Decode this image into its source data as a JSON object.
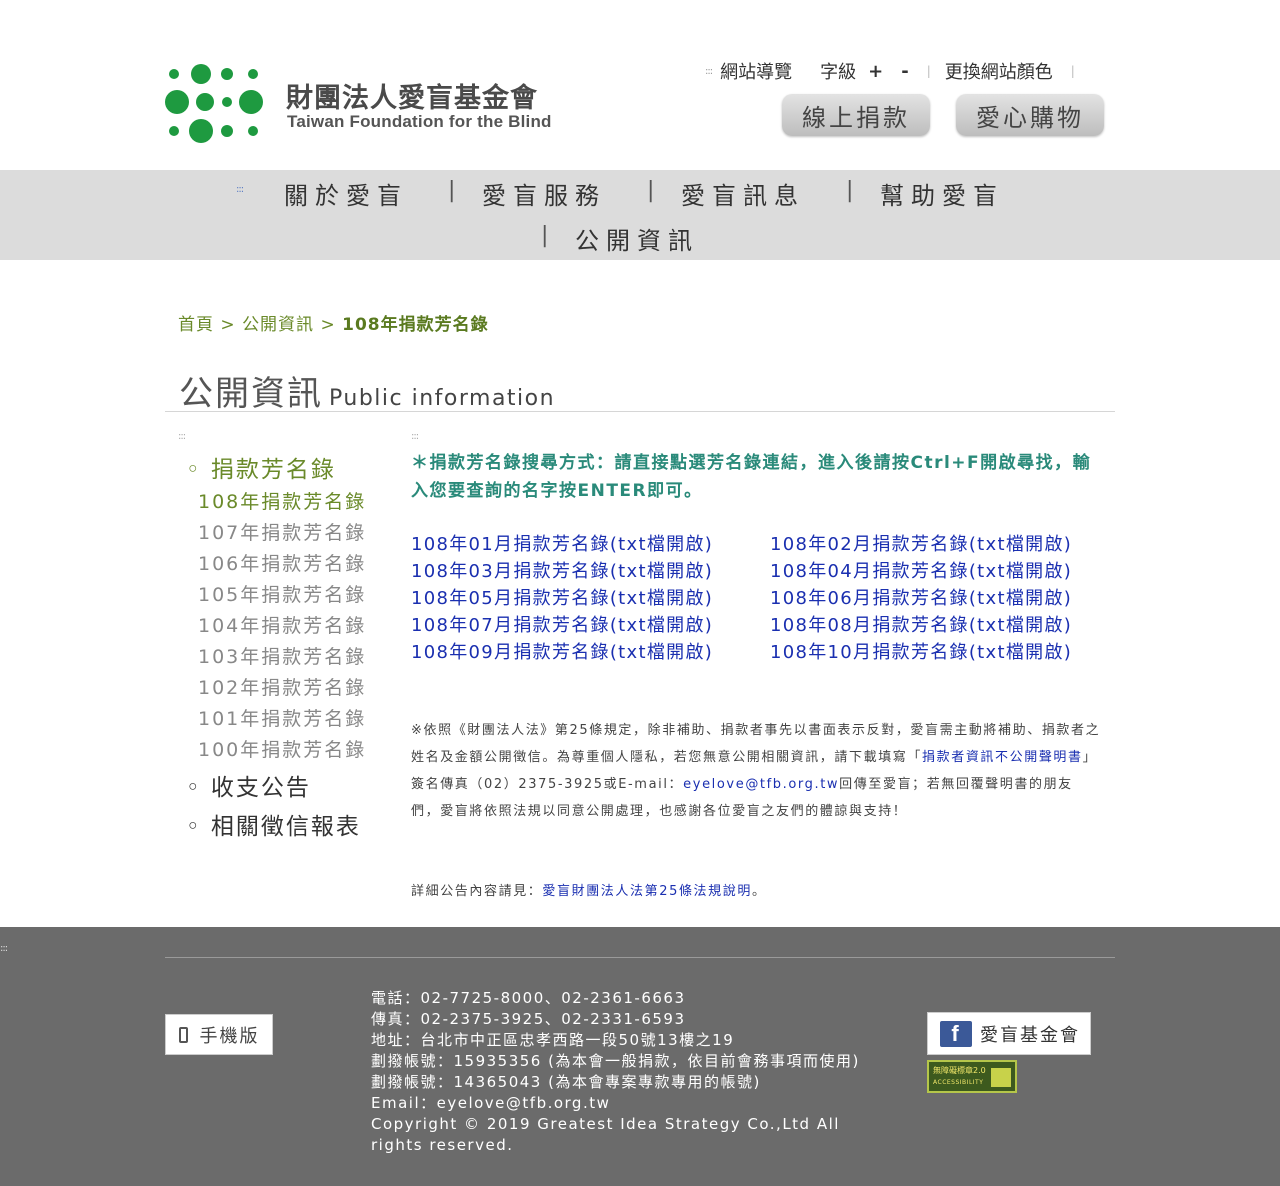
{
  "header": {
    "org_name_cn": "財團法人愛盲基金會",
    "org_name_en": "Taiwan Foundation for the Blind",
    "sitemap_label": "網站導覽",
    "font_size_label": "字級",
    "font_increase": "+",
    "font_decrease": "-",
    "change_color_label": "更換網站顏色",
    "donate_button": "線上捐款",
    "shop_button": "愛心購物",
    "accent_green": "#1e9a40"
  },
  "nav": {
    "items": [
      "關於愛盲",
      "愛盲服務",
      "愛盲訊息",
      "幫助愛盲",
      "公開資訊"
    ],
    "separator": "|"
  },
  "breadcrumb": {
    "home": "首頁",
    "section": "公開資訊",
    "current": "108年捐款芳名錄",
    "separator": ">"
  },
  "page_title": {
    "cn": "公開資訊",
    "en": "Public information"
  },
  "sidebar": {
    "cat_donors": "◦ 捐款芳名錄",
    "sub_items": [
      "108年捐款芳名錄",
      "107年捐款芳名錄",
      "106年捐款芳名錄",
      "105年捐款芳名錄",
      "104年捐款芳名錄",
      "103年捐款芳名錄",
      "102年捐款芳名錄",
      "101年捐款芳名錄",
      "100年捐款芳名錄"
    ],
    "cat_finance": "◦ 收支公告",
    "cat_reports": "◦ 相關徵信報表"
  },
  "content": {
    "notice": "＊捐款芳名錄搜尋方式：請直接點選芳名錄連結，進入後請按Ctrl+F開啟尋找，輸入您要查詢的名字按ENTER即可。",
    "month_links": [
      "108年01月捐款芳名錄(txt檔開啟)",
      "108年02月捐款芳名錄(txt檔開啟)",
      "108年03月捐款芳名錄(txt檔開啟)",
      "108年04月捐款芳名錄(txt檔開啟)",
      "108年05月捐款芳名錄(txt檔開啟)",
      "108年06月捐款芳名錄(txt檔開啟)",
      "108年07月捐款芳名錄(txt檔開啟)",
      "108年08月捐款芳名錄(txt檔開啟)",
      "108年09月捐款芳名錄(txt檔開啟)",
      "108年10月捐款芳名錄(txt檔開啟)"
    ],
    "legal_part1": "※依照《財團法人法》第25條規定，除非補助、捐款者事先以書面表示反對，愛盲需主動將補助、捐款者之姓名及金額公開徵信。為尊重個人隱私，若您無意公開相關資訊，請下載填寫「",
    "legal_link": "捐款者資訊不公開聲明書",
    "legal_part2": "」簽名傳真（02）2375-3925或E-mail：",
    "legal_email": "eyelove@tfb.org.tw",
    "legal_part3": "回傳至愛盲；若無回覆聲明書的朋友們，愛盲將依照法規以同意公開處理，也感謝各位愛盲之友們的體諒與支持！",
    "detail_prefix": "詳細公告內容請見：",
    "detail_link": "愛盲財團法人法第25條法規說明",
    "detail_suffix": "。"
  },
  "footer": {
    "mobile_label": "手機版",
    "phone": "電話：02-7725-8000、02-2361-6663",
    "fax": "傳真：02-2375-3925、02-2331-6593",
    "address": "地址：台北市中正區忠孝西路一段50號13樓之19",
    "account1": "劃撥帳號：15935356 (為本會一般捐款，依目前會務事項而使用)",
    "account2": "劃撥帳號：14365043 (為本會專案專款專用的帳號)",
    "email": "Email：eyelove@tfb.org.tw",
    "copyright": "Copyright © 2019 Greatest Idea Strategy Co.,Ltd All rights reserved.",
    "facebook_label": "愛盲基金會",
    "facebook_letter": "f",
    "a11y_badge_line1": "無障礙標章2.0",
    "a11y_badge_line2": "ACCESSIBILITY"
  }
}
